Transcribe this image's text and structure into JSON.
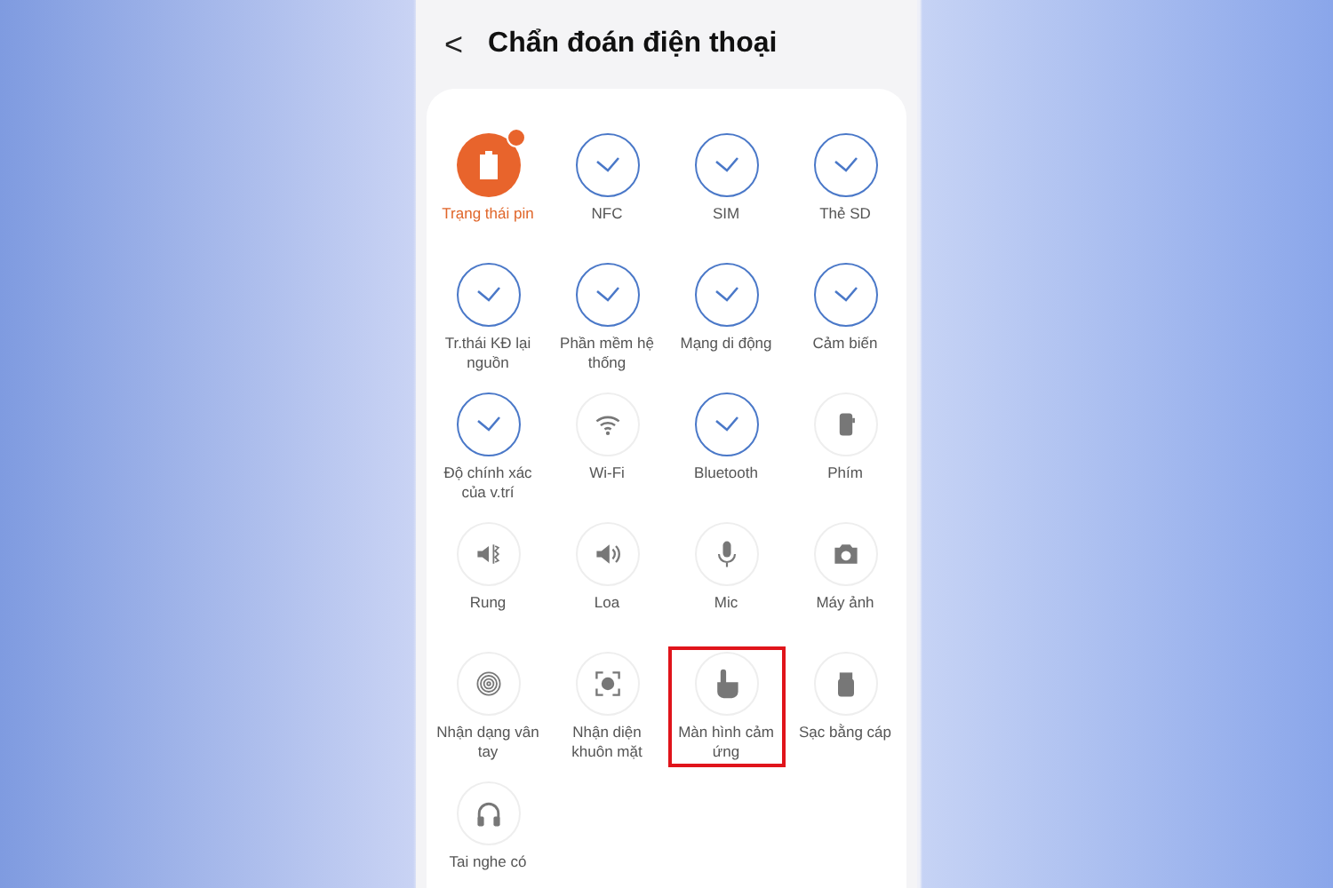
{
  "header": {
    "back": "<",
    "title": "Chẩn đoán điện thoại"
  },
  "tests": [
    {
      "label": "Trạng thái pin",
      "kind": "warning",
      "highlighted": false
    },
    {
      "label": "NFC",
      "kind": "passed",
      "highlighted": false
    },
    {
      "label": "SIM",
      "kind": "passed",
      "highlighted": false
    },
    {
      "label": "Thẻ SD",
      "kind": "passed",
      "highlighted": false
    },
    {
      "label": "Tr.thái KĐ lại nguồn",
      "kind": "passed",
      "highlighted": false
    },
    {
      "label": "Phần mềm hệ thống",
      "kind": "passed",
      "highlighted": false
    },
    {
      "label": "Mạng di động",
      "kind": "passed",
      "highlighted": false
    },
    {
      "label": "Cảm biến",
      "kind": "passed",
      "highlighted": false
    },
    {
      "label": "Độ chính xác của v.trí",
      "kind": "passed",
      "highlighted": false
    },
    {
      "label": "Wi-Fi",
      "kind": "untested",
      "highlighted": false
    },
    {
      "label": "Bluetooth",
      "kind": "passed",
      "highlighted": false
    },
    {
      "label": "Phím",
      "kind": "untested",
      "highlighted": false
    },
    {
      "label": "Rung",
      "kind": "untested",
      "highlighted": false
    },
    {
      "label": "Loa",
      "kind": "untested",
      "highlighted": false
    },
    {
      "label": "Mic",
      "kind": "untested",
      "highlighted": false
    },
    {
      "label": "Máy ảnh",
      "kind": "untested",
      "highlighted": false
    },
    {
      "label": "Nhận dạng vân tay",
      "kind": "untested",
      "highlighted": false
    },
    {
      "label": "Nhận diện khuôn mặt",
      "kind": "untested",
      "highlighted": false
    },
    {
      "label": "Màn hình cảm ứng",
      "kind": "untested",
      "highlighted": true
    },
    {
      "label": "Sạc bằng cáp",
      "kind": "untested",
      "highlighted": false
    },
    {
      "label": "Tai nghe có",
      "kind": "untested",
      "highlighted": false
    }
  ]
}
